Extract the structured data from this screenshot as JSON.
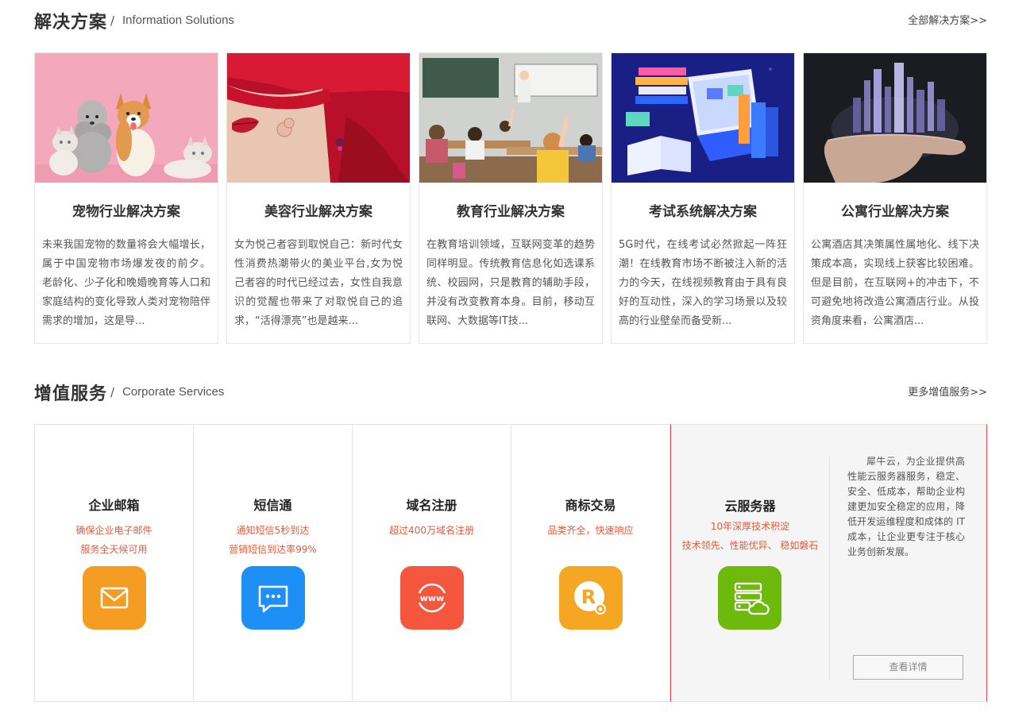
{
  "solutions": {
    "title": "解决方案",
    "slash": "/",
    "subtitle": "Information Solutions",
    "more": "全部解决方案>>",
    "cards": [
      {
        "title": "宠物行业解决方案",
        "desc": " 未来我国宠物的数量将会大幅增长，属于中国宠物市场爆发夜的前夕。 老龄化、少子化和晚婚晚育等人口和家庭结构的变化导致人类对宠物陪伴需求的增加，这是导..."
      },
      {
        "title": "美容行业解决方案",
        "desc": "女为悦己者容到取悦自己：新时代女性消费热潮带火的美业平台,女为悦己者容的时代已经过去，女性自我意识的觉醒也带来了对取悦自己的追求，“活得漂亮”也是越来..."
      },
      {
        "title": "教育行业解决方案",
        "desc": "在教育培训领域，互联网变革的趋势同样明显。传统教育信息化如选课系统、校园网，只是教育的辅助手段，并没有改变教育本身。目前，移动互联网、大数据等IT技..."
      },
      {
        "title": "考试系统解决方案",
        "desc": " 5G时代，在线考试必然掀起一阵狂潮！在线教育市场不断被注入新的活力的今天，在线视频教育由于具有良好的互动性，深入的学习场景以及较高的行业壁垒而备受新..."
      },
      {
        "title": "公寓行业解决方案",
        "desc": "公寓酒店其决策属性属地化、线下决策成本高，实现线上获客比较困难。但是目前，在互联网+的冲击下，不可避免地将改造公寓酒店行业。从投资角度来看，公寓酒店..."
      }
    ]
  },
  "services": {
    "title": "增值服务",
    "slash": "/",
    "subtitle": "Corporate Services",
    "more": "更多增值服务>>",
    "items": [
      {
        "name": "企业邮箱",
        "desc1": "确保企业电子邮件",
        "desc2": "服务全天候可用",
        "icon": "mail-icon",
        "color": "#f59d23"
      },
      {
        "name": "短信通",
        "desc1": "通知短信5秒到达",
        "desc2": "营销短信到达率99%",
        "icon": "chat-icon",
        "color": "#1e90f5"
      },
      {
        "name": "域名注册",
        "desc1": "超过400万域名注册",
        "desc2": "",
        "icon": "www-icon",
        "color": "#f4573d"
      },
      {
        "name": "商标交易",
        "desc1": "品类齐全，快速响应",
        "desc2": "",
        "icon": "trademark-icon",
        "color": "#f5a623"
      }
    ],
    "featured": {
      "name": "云服务器",
      "desc1": "10年深厚技术积淀",
      "desc2": "技术领先、性能优异、 稳如磐石",
      "icon": "cloud-server-icon",
      "color": "#6dba0c",
      "text": "犀牛云，为企业提供高性能云服务器服务，稳定、安全、低成本，帮助企业构建更加安全稳定的应用，降低开发运维程度和成体的 IT 成本，让企业更专注于核心业务创新发展。",
      "button": "查看详情"
    }
  }
}
